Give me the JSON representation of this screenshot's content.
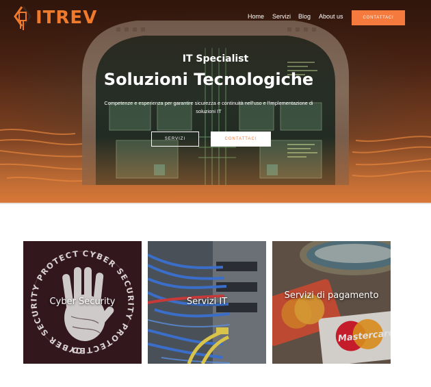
{
  "brand": {
    "logo_text": "ITREV",
    "accent": "#f47a3e"
  },
  "nav": {
    "items": [
      "Home",
      "Servizi",
      "Blog",
      "About us"
    ],
    "cta_label": "CONTATTACI"
  },
  "hero": {
    "kicker": "IT Specialist",
    "title": "Soluzioni Tecnologiche",
    "subtitle": "Competenze e esperienza per garantire sicurezza e continuità nell'uso e l'implementazione di soluzioni IT",
    "btn_primary": "SERVIZI",
    "btn_secondary": "CONTATTACI"
  },
  "cards": [
    {
      "title": "Cyber Security",
      "image_text": "CYBER SECURITY PROTECTED"
    },
    {
      "title": "Servizi IT"
    },
    {
      "title": "Servizi di pagamento",
      "image_text": "Mastercard"
    }
  ]
}
